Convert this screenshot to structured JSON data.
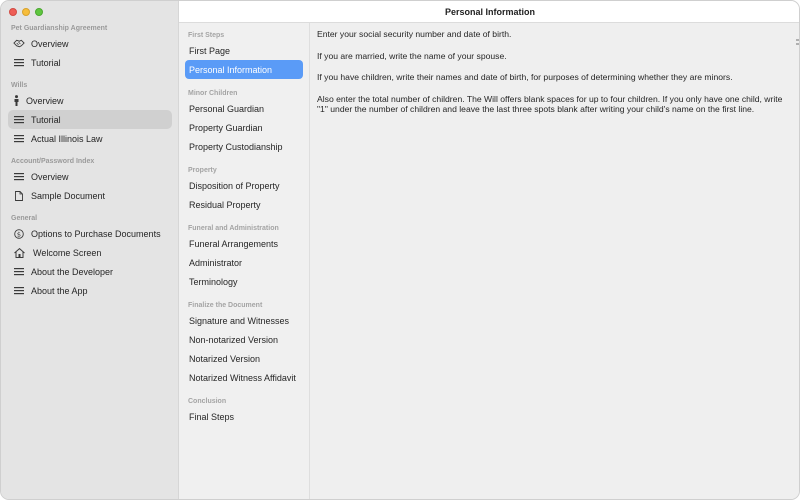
{
  "window": {
    "title": "Personal Information"
  },
  "sidebar": {
    "sections": [
      {
        "header": "Pet Guardianship Agreement",
        "items": [
          {
            "label": "Overview",
            "icon": "handshake-icon"
          },
          {
            "label": "Tutorial",
            "icon": "list-icon"
          }
        ]
      },
      {
        "header": "Wills",
        "items": [
          {
            "label": "Overview",
            "icon": "person-icon"
          },
          {
            "label": "Tutorial",
            "icon": "list-icon",
            "selected": true
          },
          {
            "label": "Actual Illinois Law",
            "icon": "list-icon"
          }
        ]
      },
      {
        "header": "Account/Password Index",
        "items": [
          {
            "label": "Overview",
            "icon": "list-icon"
          },
          {
            "label": "Sample Document",
            "icon": "document-icon"
          }
        ]
      },
      {
        "header": "General",
        "items": [
          {
            "label": "Options to Purchase Documents",
            "icon": "dollar-circle-icon"
          },
          {
            "label": "Welcome Screen",
            "icon": "house-icon"
          },
          {
            "label": "About the Developer",
            "icon": "list-icon"
          },
          {
            "label": "About the App",
            "icon": "list-icon"
          }
        ]
      }
    ]
  },
  "midlist": {
    "sections": [
      {
        "header": "First Steps",
        "items": [
          {
            "label": "First Page"
          },
          {
            "label": "Personal Information",
            "selected": true
          }
        ]
      },
      {
        "header": "Minor Children",
        "items": [
          {
            "label": "Personal Guardian"
          },
          {
            "label": "Property Guardian"
          },
          {
            "label": "Property Custodianship"
          }
        ]
      },
      {
        "header": "Property",
        "items": [
          {
            "label": "Disposition of Property"
          },
          {
            "label": "Residual Property"
          }
        ]
      },
      {
        "header": "Funeral and Administration",
        "items": [
          {
            "label": "Funeral Arrangements"
          },
          {
            "label": "Administrator"
          },
          {
            "label": "Terminology"
          }
        ]
      },
      {
        "header": "Finalize the Document",
        "items": [
          {
            "label": "Signature and Witnesses"
          },
          {
            "label": "Non-notarized Version"
          },
          {
            "label": "Notarized Version"
          },
          {
            "label": "Notarized Witness Affidavit"
          }
        ]
      },
      {
        "header": "Conclusion",
        "items": [
          {
            "label": "Final Steps"
          }
        ]
      }
    ]
  },
  "content": {
    "paragraphs": [
      "Enter your social security number and date of birth.",
      "If you are married, write the name of your spouse.",
      "If you have children, write their names and date of birth, for purposes of determining whether they are minors.",
      "Also enter the total number of children. The Will offers blank spaces for up to four children. If you only have one child, write \"1\" under the number of children and leave the last three spots blank after writing your child's name on the first line."
    ]
  },
  "colors": {
    "accent": "#5a9bf7",
    "sidebar_bg": "#e4e4e4",
    "content_bg": "#efefef",
    "close": "#ee5e56",
    "minimize": "#f6bd3b",
    "zoom": "#5fc640"
  }
}
